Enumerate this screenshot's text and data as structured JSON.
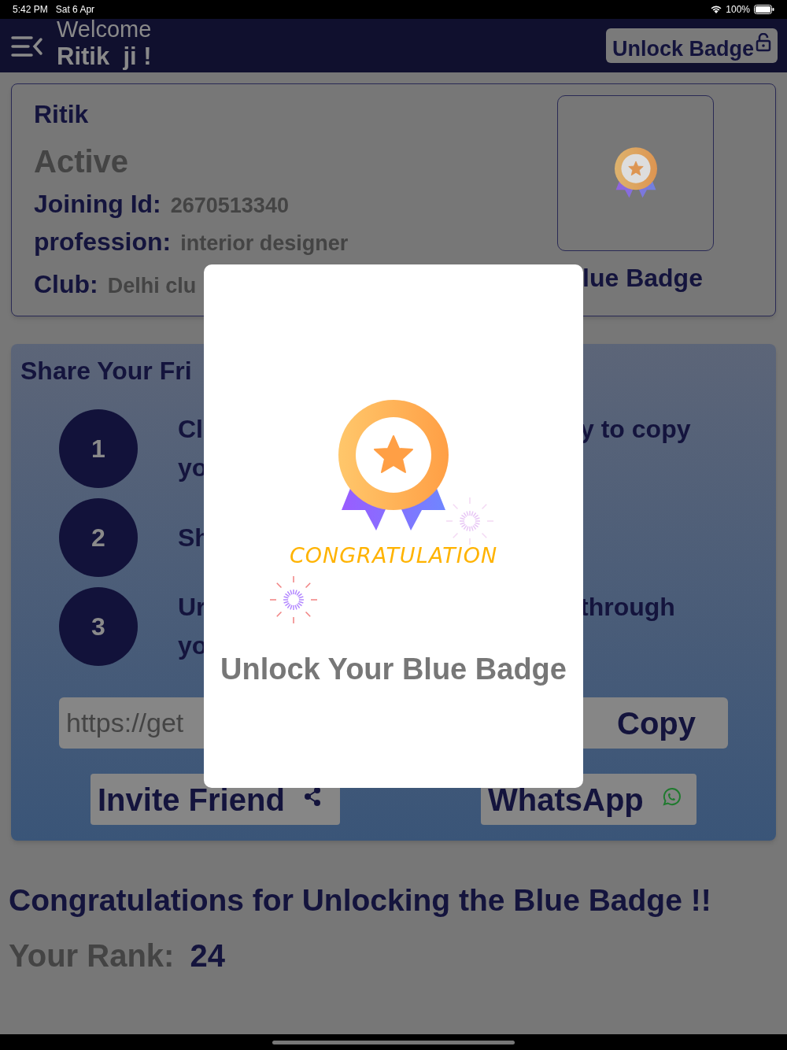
{
  "status_bar": {
    "time": "5:42 PM",
    "date": "Sat 6 Apr",
    "battery": "100%"
  },
  "header": {
    "welcome": "Welcome",
    "name": "Ritik  ji !",
    "unlock_button": "Unlock Badge"
  },
  "profile": {
    "name": "Ritik",
    "status": "Active",
    "fields": [
      {
        "label": "Joining Id:",
        "value": "2670513340"
      },
      {
        "label": "profession:",
        "value": "interior designer"
      },
      {
        "label": "Club:",
        "value": "Delhi clu"
      }
    ],
    "badge_caption": "lue Badge"
  },
  "share": {
    "title": "Share Your Fri",
    "steps": [
      {
        "number": "1",
        "left": [
          "Cl",
          "yo"
        ],
        "right": "y to copy"
      },
      {
        "number": "2",
        "left": [
          "Sh"
        ]
      },
      {
        "number": "3",
        "left": [
          "Ur",
          "yo"
        ],
        "right": "through"
      }
    ],
    "link": "https://get",
    "copy_button": "Copy",
    "invite_button": "Invite Friend",
    "whatsapp_button": "WhatsApp"
  },
  "message": "Congratulations for Unlocking the Blue Badge !!",
  "rank": {
    "label": "Your Rank:",
    "value": "24"
  },
  "modal": {
    "caption": "CONGRATULATION",
    "title": "Unlock Your Blue Badge"
  }
}
